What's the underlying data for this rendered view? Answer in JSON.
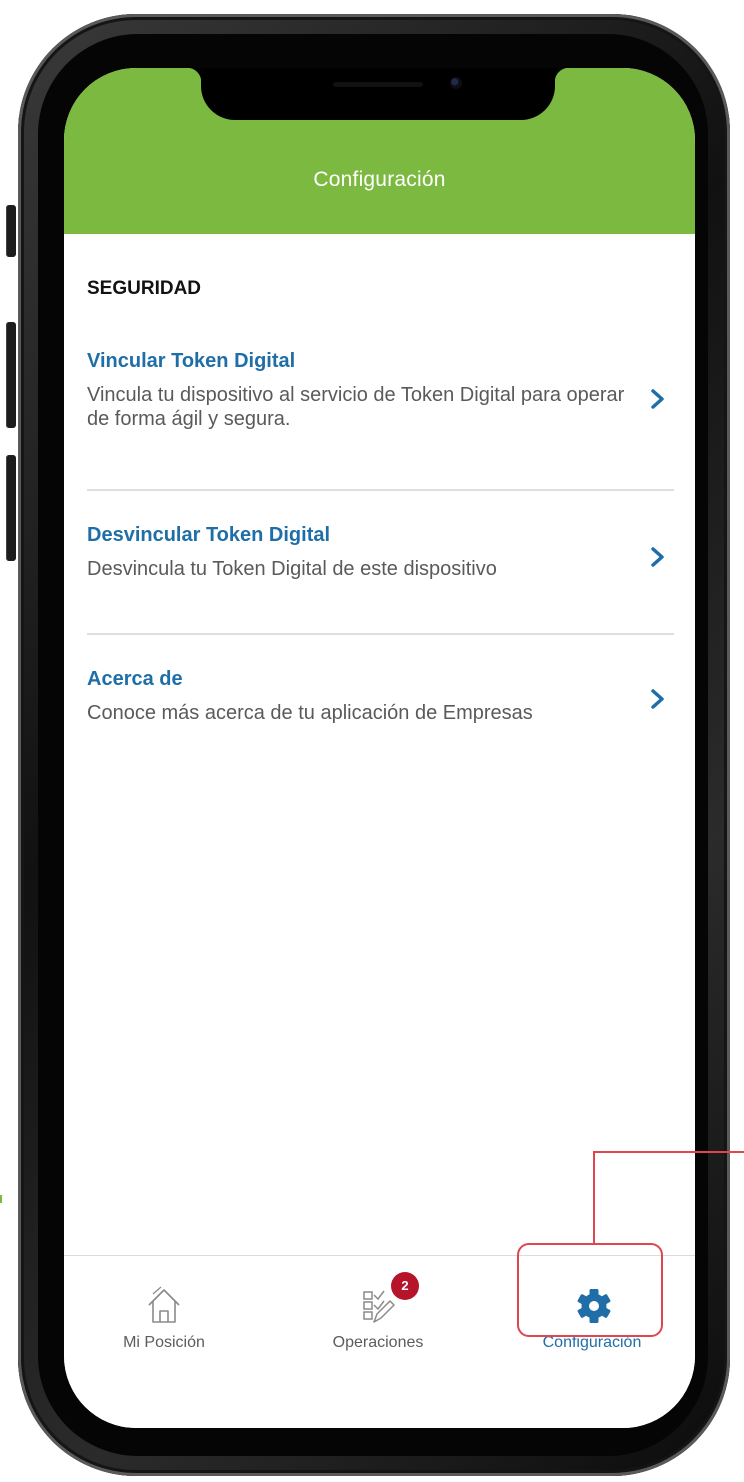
{
  "header": {
    "title": "Configuración"
  },
  "section": {
    "title": "SEGURIDAD"
  },
  "items": [
    {
      "title": "Vincular Token Digital",
      "description": "Vincula tu dispositivo al servicio de Token Digital para operar de forma ágil y segura."
    },
    {
      "title": "Desvincular Token Digital",
      "description": "Desvincula tu Token Digital de este dispositivo"
    },
    {
      "title": "Acerca de",
      "description": "Conoce más acerca de tu aplicación de Empresas"
    }
  ],
  "tabbar": {
    "tabs": [
      {
        "label": "Mi Posición",
        "icon": "home-icon",
        "active": false
      },
      {
        "label": "Operaciones",
        "icon": "operations-checklist-icon",
        "active": false,
        "badge": "2"
      },
      {
        "label": "Configuración",
        "icon": "gear-icon",
        "active": true
      }
    ]
  },
  "colors": {
    "header_green": "#7cb940",
    "link_blue": "#1f6ea8",
    "badge_red": "#b5142b",
    "highlight_red": "#e0464f"
  }
}
